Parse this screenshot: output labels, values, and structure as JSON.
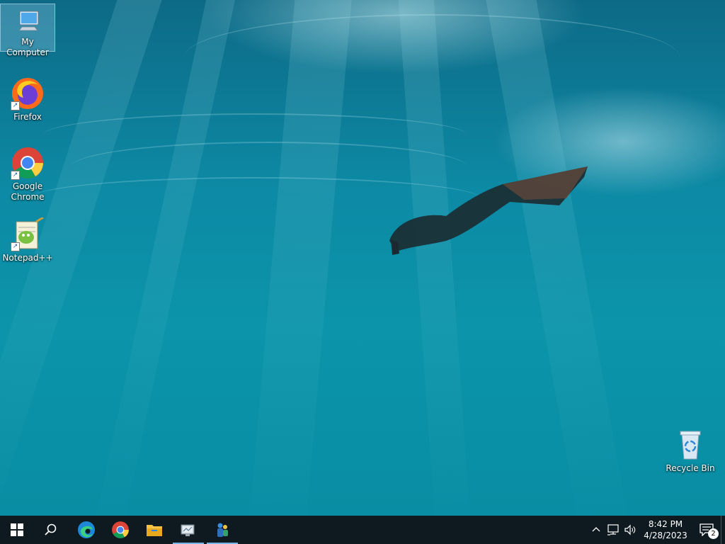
{
  "desktop": {
    "icons": [
      {
        "label": "My Computer",
        "selected": true,
        "icon": "computer-icon"
      },
      {
        "label": "Firefox",
        "icon": "firefox-icon",
        "shortcut": true
      },
      {
        "label": "Google Chrome",
        "icon": "chrome-icon",
        "shortcut": true
      },
      {
        "label": "Notepad++",
        "icon": "notepadpp-icon",
        "shortcut": true
      },
      {
        "label": "Recycle Bin",
        "icon": "recycle-bin-icon"
      }
    ]
  },
  "taskbar": {
    "pinned": [
      {
        "name": "start-button",
        "icon": "windows-logo-icon"
      },
      {
        "name": "search-button",
        "icon": "search-icon"
      },
      {
        "name": "edge-button",
        "icon": "edge-icon"
      },
      {
        "name": "chrome-button",
        "icon": "chrome-icon"
      },
      {
        "name": "file-explorer-button",
        "icon": "folder-icon"
      },
      {
        "name": "server-manager-button",
        "icon": "server-manager-icon",
        "active": true
      },
      {
        "name": "active-directory-button",
        "icon": "ad-users-icon",
        "active": true
      }
    ],
    "tray": {
      "time": "8:42 PM",
      "date": "4/28/2023",
      "notification_count": "2"
    }
  },
  "colors": {
    "taskbar_bg": "#0f1a20",
    "active_indicator": "#79b8e6",
    "water_top": "#0d6a86",
    "water_bottom": "#088ca3"
  }
}
